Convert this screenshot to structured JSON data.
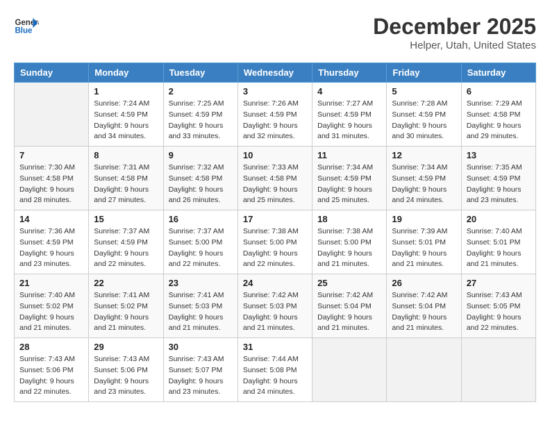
{
  "header": {
    "logo_line1": "General",
    "logo_line2": "Blue",
    "month": "December 2025",
    "location": "Helper, Utah, United States"
  },
  "weekdays": [
    "Sunday",
    "Monday",
    "Tuesday",
    "Wednesday",
    "Thursday",
    "Friday",
    "Saturday"
  ],
  "weeks": [
    [
      {
        "day": "",
        "empty": true
      },
      {
        "day": "1",
        "sunrise": "7:24 AM",
        "sunset": "4:59 PM",
        "daylight": "9 hours and 34 minutes."
      },
      {
        "day": "2",
        "sunrise": "7:25 AM",
        "sunset": "4:59 PM",
        "daylight": "9 hours and 33 minutes."
      },
      {
        "day": "3",
        "sunrise": "7:26 AM",
        "sunset": "4:59 PM",
        "daylight": "9 hours and 32 minutes."
      },
      {
        "day": "4",
        "sunrise": "7:27 AM",
        "sunset": "4:59 PM",
        "daylight": "9 hours and 31 minutes."
      },
      {
        "day": "5",
        "sunrise": "7:28 AM",
        "sunset": "4:59 PM",
        "daylight": "9 hours and 30 minutes."
      },
      {
        "day": "6",
        "sunrise": "7:29 AM",
        "sunset": "4:58 PM",
        "daylight": "9 hours and 29 minutes."
      }
    ],
    [
      {
        "day": "7",
        "sunrise": "7:30 AM",
        "sunset": "4:58 PM",
        "daylight": "9 hours and 28 minutes."
      },
      {
        "day": "8",
        "sunrise": "7:31 AM",
        "sunset": "4:58 PM",
        "daylight": "9 hours and 27 minutes."
      },
      {
        "day": "9",
        "sunrise": "7:32 AM",
        "sunset": "4:58 PM",
        "daylight": "9 hours and 26 minutes."
      },
      {
        "day": "10",
        "sunrise": "7:33 AM",
        "sunset": "4:58 PM",
        "daylight": "9 hours and 25 minutes."
      },
      {
        "day": "11",
        "sunrise": "7:34 AM",
        "sunset": "4:59 PM",
        "daylight": "9 hours and 25 minutes."
      },
      {
        "day": "12",
        "sunrise": "7:34 AM",
        "sunset": "4:59 PM",
        "daylight": "9 hours and 24 minutes."
      },
      {
        "day": "13",
        "sunrise": "7:35 AM",
        "sunset": "4:59 PM",
        "daylight": "9 hours and 23 minutes."
      }
    ],
    [
      {
        "day": "14",
        "sunrise": "7:36 AM",
        "sunset": "4:59 PM",
        "daylight": "9 hours and 23 minutes."
      },
      {
        "day": "15",
        "sunrise": "7:37 AM",
        "sunset": "4:59 PM",
        "daylight": "9 hours and 22 minutes."
      },
      {
        "day": "16",
        "sunrise": "7:37 AM",
        "sunset": "5:00 PM",
        "daylight": "9 hours and 22 minutes."
      },
      {
        "day": "17",
        "sunrise": "7:38 AM",
        "sunset": "5:00 PM",
        "daylight": "9 hours and 22 minutes."
      },
      {
        "day": "18",
        "sunrise": "7:38 AM",
        "sunset": "5:00 PM",
        "daylight": "9 hours and 21 minutes."
      },
      {
        "day": "19",
        "sunrise": "7:39 AM",
        "sunset": "5:01 PM",
        "daylight": "9 hours and 21 minutes."
      },
      {
        "day": "20",
        "sunrise": "7:40 AM",
        "sunset": "5:01 PM",
        "daylight": "9 hours and 21 minutes."
      }
    ],
    [
      {
        "day": "21",
        "sunrise": "7:40 AM",
        "sunset": "5:02 PM",
        "daylight": "9 hours and 21 minutes."
      },
      {
        "day": "22",
        "sunrise": "7:41 AM",
        "sunset": "5:02 PM",
        "daylight": "9 hours and 21 minutes."
      },
      {
        "day": "23",
        "sunrise": "7:41 AM",
        "sunset": "5:03 PM",
        "daylight": "9 hours and 21 minutes."
      },
      {
        "day": "24",
        "sunrise": "7:42 AM",
        "sunset": "5:03 PM",
        "daylight": "9 hours and 21 minutes."
      },
      {
        "day": "25",
        "sunrise": "7:42 AM",
        "sunset": "5:04 PM",
        "daylight": "9 hours and 21 minutes."
      },
      {
        "day": "26",
        "sunrise": "7:42 AM",
        "sunset": "5:04 PM",
        "daylight": "9 hours and 21 minutes."
      },
      {
        "day": "27",
        "sunrise": "7:43 AM",
        "sunset": "5:05 PM",
        "daylight": "9 hours and 22 minutes."
      }
    ],
    [
      {
        "day": "28",
        "sunrise": "7:43 AM",
        "sunset": "5:06 PM",
        "daylight": "9 hours and 22 minutes."
      },
      {
        "day": "29",
        "sunrise": "7:43 AM",
        "sunset": "5:06 PM",
        "daylight": "9 hours and 23 minutes."
      },
      {
        "day": "30",
        "sunrise": "7:43 AM",
        "sunset": "5:07 PM",
        "daylight": "9 hours and 23 minutes."
      },
      {
        "day": "31",
        "sunrise": "7:44 AM",
        "sunset": "5:08 PM",
        "daylight": "9 hours and 24 minutes."
      },
      {
        "day": "",
        "empty": true
      },
      {
        "day": "",
        "empty": true
      },
      {
        "day": "",
        "empty": true
      }
    ]
  ]
}
